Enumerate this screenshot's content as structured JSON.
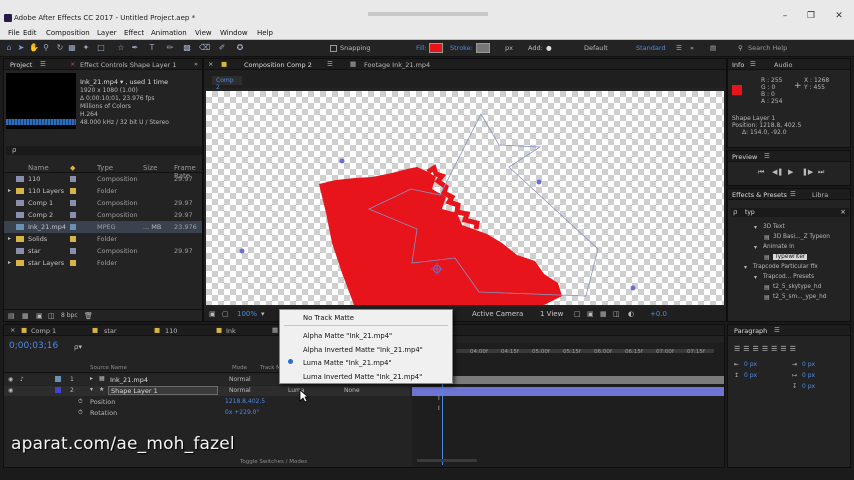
{
  "window": {
    "title": "Adobe After Effects CC 2017 - Untitled Project.aep *",
    "buttons": [
      "–",
      "❐",
      "✕"
    ]
  },
  "menu": [
    "File",
    "Edit",
    "Composition",
    "Layer",
    "Effect",
    "Animation",
    "View",
    "Window",
    "Help"
  ],
  "toolbar": {
    "snapping": "Snapping",
    "fill": "Fill:",
    "stroke": "Stroke:",
    "px": "px",
    "add": "Add:",
    "workspace_default": "Default",
    "workspace_standard": "Standard",
    "search_placeholder": "Search Help",
    "fill_color": "#e8141c",
    "stroke_color": "#777777"
  },
  "project_panel": {
    "tab": "Project",
    "tab2": "Effect Controls Shape Layer 1",
    "info": {
      "name": "Ink_21.mp4 ▾ , used 1 time",
      "line1": "1920 x 1080 (1.00)",
      "line2": "Δ 0;00:10;01, 23.976 fps",
      "line3": "Millions of Colors",
      "line4": "H.264",
      "line5": "48.000 kHz / 32 bit U / Stereo"
    },
    "search_placeholder": "ρ",
    "headers": {
      "name": "Name",
      "type": "Type",
      "size": "Size",
      "frame_rate": "Frame Rate"
    },
    "items": [
      {
        "name": "110",
        "type": "Composition",
        "fr": "29.97",
        "color": "#8a8fb0"
      },
      {
        "name": "110 Layers",
        "type": "Folder",
        "fr": "",
        "color": "#d6b546"
      },
      {
        "name": "Comp 1",
        "type": "Composition",
        "fr": "29.97",
        "color": "#8a8fb0"
      },
      {
        "name": "Comp 2",
        "type": "Composition",
        "fr": "29.97",
        "color": "#8a8fb0"
      },
      {
        "name": "Ink_21.mp4",
        "type": "MPEG",
        "size": "... MB",
        "fr": "23.976",
        "color": "#6c8fb4"
      },
      {
        "name": "Solids",
        "type": "Folder",
        "fr": "",
        "color": "#d6b546"
      },
      {
        "name": "star",
        "type": "Composition",
        "fr": "29.97",
        "color": "#8a8fb0"
      },
      {
        "name": "star Layers",
        "type": "Folder",
        "fr": "",
        "color": "#d6b546"
      }
    ],
    "bpc": "8 bpc"
  },
  "comp_panel": {
    "tab": "Composition Comp 2",
    "footage_tab": "Footage Ink_21.mp4",
    "breadcrumb": "Comp 2",
    "zoom": "100%",
    "camera": "Active Camera",
    "view": "1 View",
    "exposure": "+0.0"
  },
  "matte_menu": {
    "items": [
      {
        "label": "No Track Matte",
        "selected": false
      },
      {
        "label": "Alpha Matte \"Ink_21.mp4\"",
        "selected": false
      },
      {
        "label": "Alpha Inverted Matte \"Ink_21.mp4\"",
        "selected": false
      },
      {
        "label": "Luma Matte \"Ink_21.mp4\"",
        "selected": true
      },
      {
        "label": "Luma Inverted Matte \"Ink_21.mp4\"",
        "selected": false
      }
    ]
  },
  "info_panel": {
    "tab": "Info",
    "tab2": "Audio",
    "r": "R : 255",
    "g": "G : 0",
    "b": "B : 0",
    "a": "A : 254",
    "x": "X : 1268",
    "y": "Y : 455",
    "layer": "Shape Layer 1",
    "position": "Position: 1218.8, 402.5",
    "delta": "Δ: 154.0, -92.0"
  },
  "preview_panel": {
    "tab": "Preview"
  },
  "effects_panel": {
    "tab": "Effects & Presets",
    "tab2": "Libra",
    "search": "typ",
    "items": [
      {
        "label": "3D Text",
        "indent": 2
      },
      {
        "label": "3D Basi..._Z Typeon",
        "indent": 3
      },
      {
        "label": "Animate In",
        "indent": 2
      },
      {
        "label": "Typewriter",
        "indent": 3
      },
      {
        "label": "Trapcode Particular ffx",
        "indent": 1
      },
      {
        "label": "Trapcod... Presets",
        "indent": 2
      },
      {
        "label": "t2_5_skytype_hd",
        "indent": 3
      },
      {
        "label": "t2_5_sm..._ype_hd",
        "indent": 3
      }
    ]
  },
  "timeline": {
    "tabs": [
      "Comp 1",
      "star",
      "110",
      "Ink"
    ],
    "timecode": "0;00;03;16",
    "headers": {
      "source": "Source Name",
      "mode": "Mode",
      "trkmat": "Track Mat"
    },
    "layers": [
      {
        "num": "1",
        "name": "Ink_21.mp4",
        "mode": "Normal"
      },
      {
        "num": "2",
        "name": "Shape Layer 1",
        "mode": "Normal",
        "trkmat": "Luma",
        "parent": "None"
      }
    ],
    "properties": [
      {
        "name": "Position",
        "value": "1218.8,402.5"
      },
      {
        "name": "Rotation",
        "value": "0x +229.0°"
      }
    ],
    "ruler": [
      "04:00f",
      "04:15f",
      "05:00f",
      "05:15f",
      "06:00f",
      "06:15f",
      "07:00f",
      "07:15f"
    ],
    "toggle_label": "Toggle Switches / Modes"
  },
  "paragraph_panel": {
    "tab": "Paragraph",
    "fields": [
      "0 px",
      "0 px",
      "0 px",
      "0 px",
      "0 px"
    ]
  },
  "watermark": "aparat.com/ae_moh_fazel"
}
